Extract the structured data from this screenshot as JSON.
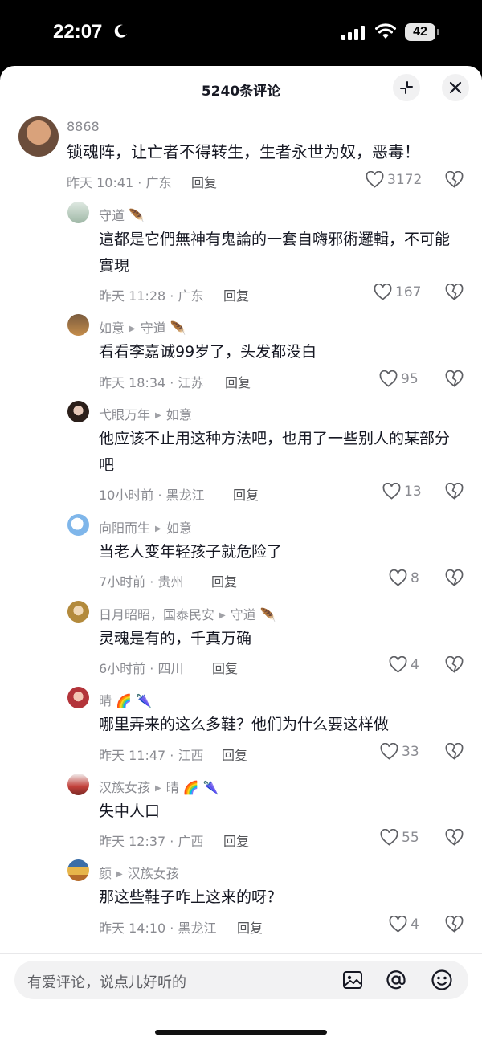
{
  "status": {
    "time": "22:07",
    "battery": "42"
  },
  "sheet": {
    "title": "5240条评论"
  },
  "comments": [
    {
      "user": "8868",
      "text": "锁魂阵，让亡者不得转生，生者永世为奴，恶毒！",
      "meta": "昨天 10:41 · 广东",
      "reply": "回复",
      "likes": "3172"
    },
    {
      "user": "守道",
      "text": "這都是它們無神有鬼論的一套自嗨邪術邏輯，不可能實現",
      "meta": "昨天 11:28 · 广东",
      "reply": "回复",
      "likes": "167"
    },
    {
      "user": "如意",
      "reply_to": "守道",
      "text": "看看李嘉诚99岁了，头发都没白",
      "meta": "昨天 18:34 · 江苏",
      "reply": "回复",
      "likes": "95"
    },
    {
      "user": "弋眼万年",
      "reply_to": "如意",
      "text": "他应该不止用这种方法吧，也用了一些别人的某部分吧",
      "meta": "10小时前 · 黑龙江",
      "reply": "回复",
      "likes": "13"
    },
    {
      "user": "向阳而生",
      "reply_to": "如意",
      "text": "当老人变年轻孩子就危险了",
      "meta": "7小时前 · 贵州",
      "reply": "回复",
      "likes": "8"
    },
    {
      "user": "日月昭昭，国泰民安",
      "reply_to": "守道",
      "text": "灵魂是有的，千真万确",
      "meta": "6小时前 · 四川",
      "reply": "回复",
      "likes": "4"
    },
    {
      "user": "晴",
      "text": "哪里弄来的这么多鞋？他们为什么要这样做",
      "meta": "昨天 11:47 · 江西",
      "reply": "回复",
      "likes": "33"
    },
    {
      "user": "汉族女孩",
      "reply_to": "晴",
      "text": "失中人口",
      "meta": "昨天 12:37 · 广西",
      "reply": "回复",
      "likes": "55"
    },
    {
      "user": "颜",
      "reply_to": "汉族女孩",
      "text": "那这些鞋子咋上这来的呀？",
      "meta": "昨天 14:10 · 黑龙江",
      "reply": "回复",
      "likes": "4"
    }
  ],
  "input": {
    "placeholder": "有爱评论，说点儿好听的"
  },
  "icons": {
    "collapse": "collapse-icon",
    "close": "close-icon",
    "heart": "heart-icon",
    "dislike": "broken-heart-icon",
    "image": "image-icon",
    "mention": "at-icon",
    "emoji": "emoji-icon"
  }
}
